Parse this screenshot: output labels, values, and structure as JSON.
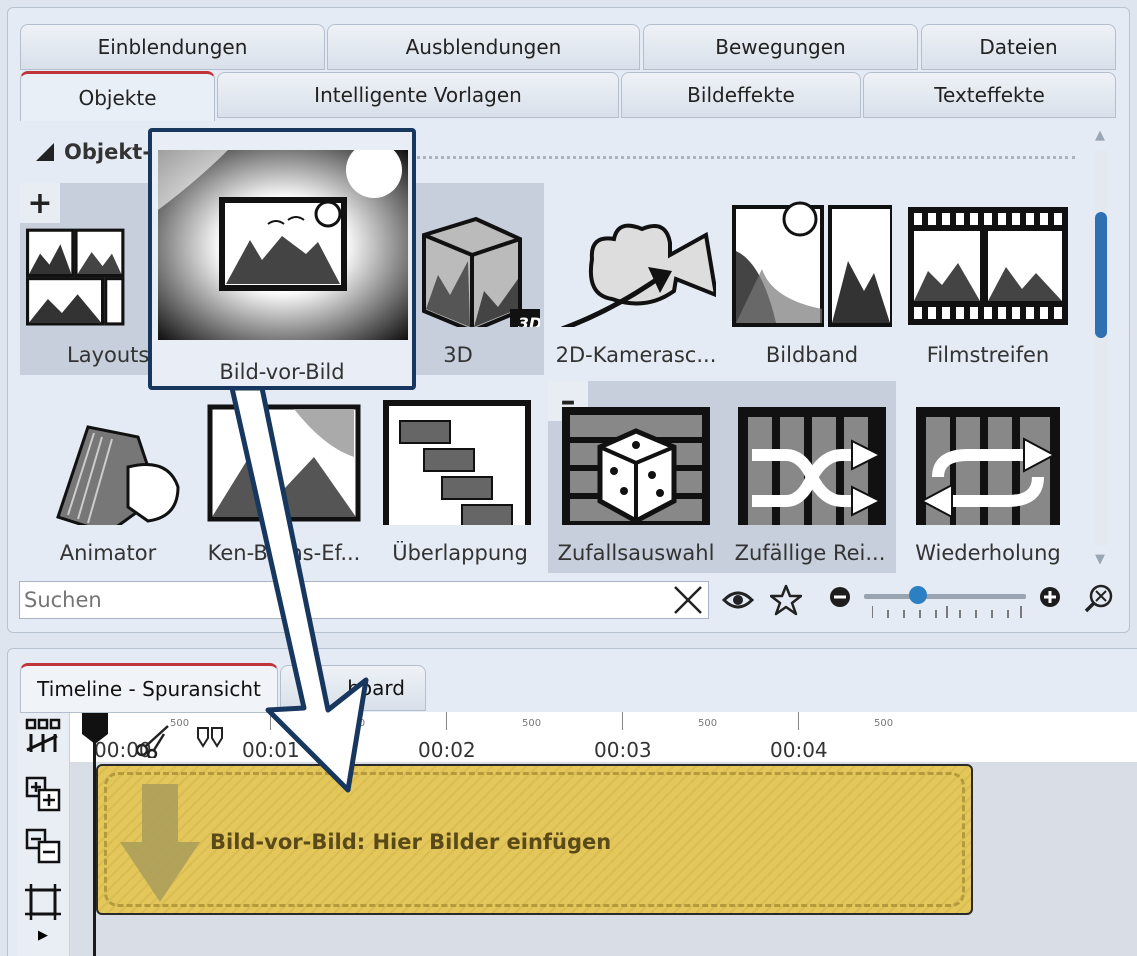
{
  "top_tabs_row1": [
    "Einblendungen",
    "Ausblendungen",
    "Bewegungen",
    "Dateien"
  ],
  "top_tabs_row2": [
    "Objekte",
    "Intelligente Vorlagen",
    "Bildeffekte",
    "Texteffekte"
  ],
  "section": {
    "title": "Objekt-"
  },
  "items_row1": [
    {
      "label": "Layouts",
      "icon": "layouts-icon"
    },
    {
      "label": "3D",
      "icon": "cube-3d-icon",
      "badge": "3D"
    },
    {
      "label": "2D-Kamerasc...",
      "icon": "camera-icon"
    },
    {
      "label": "Bildband",
      "icon": "bildband-icon"
    },
    {
      "label": "Filmstreifen",
      "icon": "filmstrip-icon"
    }
  ],
  "items_row2": [
    {
      "label": "Animator",
      "icon": "flipbook-icon"
    },
    {
      "label": "Ken-Burns-Ef...",
      "icon": "ken-burns-icon"
    },
    {
      "label": "Überlappung",
      "icon": "overlap-icon"
    },
    {
      "label": "Zufallsauswahl",
      "icon": "dice-icon"
    },
    {
      "label": "Zufällige Rei...",
      "icon": "shuffle-icon"
    },
    {
      "label": "Wiederholung",
      "icon": "repeat-icon"
    }
  ],
  "plus_symbol": "+",
  "minus_symbol": "–",
  "search": {
    "placeholder": "Suchen"
  },
  "zoom_level": 0.3,
  "timeline_tabs": [
    "Timeline - Spuransicht",
    "board"
  ],
  "ruler": {
    "times": [
      "00:00",
      "00:01",
      "00:02",
      "00:03",
      "00:04"
    ],
    "sub": "500"
  },
  "clip": {
    "text": "Bild-vor-Bild: Hier Bilder einfügen"
  },
  "drag_popup": {
    "label": "Bild-vor-Bild"
  },
  "colors": {
    "accent": "#c0353a",
    "arrow_stroke": "#17375e",
    "clip": "#e4c75a",
    "scroll": "#2f6fb2"
  }
}
